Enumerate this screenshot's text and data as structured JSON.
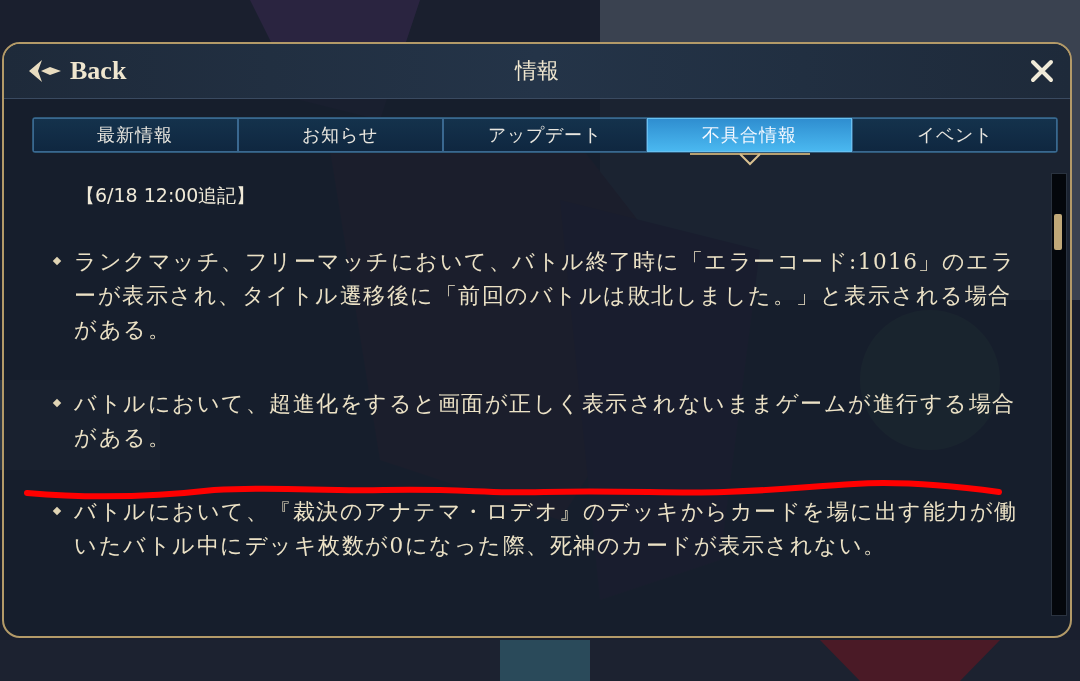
{
  "header": {
    "back_label": "Back",
    "title": "情報"
  },
  "tabs": [
    {
      "label": "最新情報",
      "selected": false
    },
    {
      "label": "お知らせ",
      "selected": false
    },
    {
      "label": "アップデート",
      "selected": false
    },
    {
      "label": "不具合情報",
      "selected": true
    },
    {
      "label": "イベント",
      "selected": false
    }
  ],
  "content": {
    "heading": "【6/18 12:00追記】",
    "items": [
      {
        "text": "ランクマッチ、フリーマッチにおいて、バトル終了時に「エラーコード:1016」のエラーが表示され、タイトル遷移後に「前回のバトルは敗北しました。」と表示される場合がある。"
      },
      {
        "text": "バトルにおいて、超進化をすると画面が正しく表示されないままゲームが進行する場合がある。"
      },
      {
        "text": "バトルにおいて、『裁決のアナテマ・ロデオ』のデッキからカードを場に出す能力が働いたバトル中にデッキ枚数が0になった際、死神のカードが表示されない。"
      }
    ]
  },
  "annotation": {
    "kind": "underline"
  }
}
